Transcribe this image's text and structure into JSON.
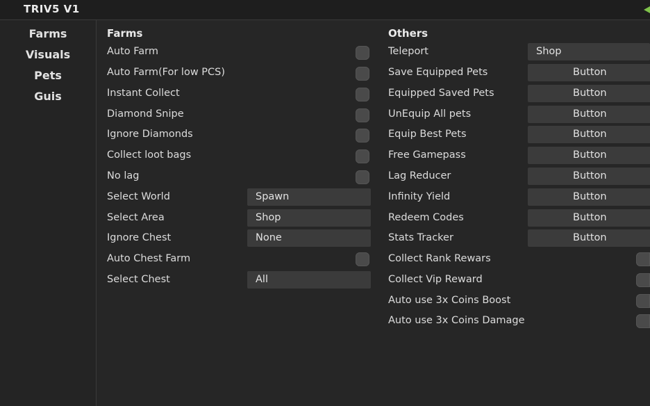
{
  "window": {
    "title": "TRIV5 V1"
  },
  "sidebar": {
    "items": [
      {
        "label": "Farms"
      },
      {
        "label": "Visuals"
      },
      {
        "label": "Pets"
      },
      {
        "label": "Guis"
      }
    ]
  },
  "farms": {
    "title": "Farms",
    "rows": [
      {
        "label": "Auto Farm",
        "type": "toggle"
      },
      {
        "label": "Auto Farm(For low PCS)",
        "type": "toggle"
      },
      {
        "label": "Instant Collect",
        "type": "toggle"
      },
      {
        "label": "Diamond Snipe",
        "type": "toggle"
      },
      {
        "label": "Ignore Diamonds",
        "type": "toggle"
      },
      {
        "label": "Collect loot bags",
        "type": "toggle"
      },
      {
        "label": "No lag",
        "type": "toggle"
      },
      {
        "label": "Select World",
        "type": "dropdown",
        "value": "Spawn"
      },
      {
        "label": "Select Area",
        "type": "dropdown",
        "value": "Shop"
      },
      {
        "label": "Ignore Chest",
        "type": "dropdown",
        "value": "None"
      },
      {
        "label": "Auto Chest Farm",
        "type": "toggle"
      },
      {
        "label": "Select Chest",
        "type": "dropdown",
        "value": "All"
      }
    ]
  },
  "others": {
    "title": "Others",
    "rows": [
      {
        "label": "Teleport",
        "type": "dropdown",
        "value": "Shop"
      },
      {
        "label": "Save Equipped Pets",
        "type": "button",
        "button_label": "Button"
      },
      {
        "label": "Equipped Saved Pets",
        "type": "button",
        "button_label": "Button"
      },
      {
        "label": "UnEquip All pets",
        "type": "button",
        "button_label": "Button"
      },
      {
        "label": "Equip Best Pets",
        "type": "button",
        "button_label": "Button"
      },
      {
        "label": "Free Gamepass",
        "type": "button",
        "button_label": "Button"
      },
      {
        "label": "Lag Reducer",
        "type": "button",
        "button_label": "Button"
      },
      {
        "label": "Infinity Yield",
        "type": "button",
        "button_label": "Button"
      },
      {
        "label": "Redeem Codes",
        "type": "button",
        "button_label": "Button"
      },
      {
        "label": "Stats Tracker",
        "type": "button",
        "button_label": "Button"
      },
      {
        "label": "Collect Rank Rewars",
        "type": "toggle"
      },
      {
        "label": "Collect Vip Reward",
        "type": "toggle"
      },
      {
        "label": "Auto use 3x Coins Boost",
        "type": "toggle"
      },
      {
        "label": "Auto use 3x Coins Damage",
        "type": "toggle"
      }
    ]
  },
  "colors": {
    "background": "#262626",
    "titlebar": "#1e1e1e",
    "control": "#3b3b3b",
    "toggle": "#4a4a4a",
    "accent": "#7fc24a"
  }
}
